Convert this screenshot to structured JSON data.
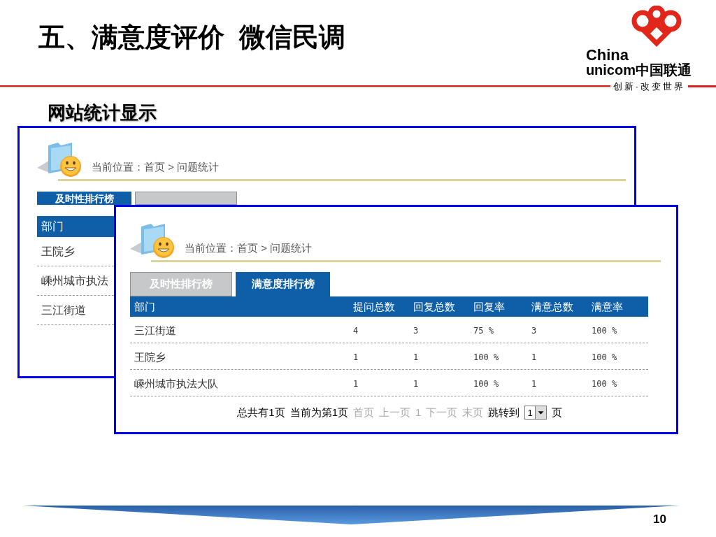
{
  "slide": {
    "title": "五、满意度评价  微信民调",
    "subtitle": "网站统计显示",
    "page_number": "10"
  },
  "logo": {
    "line_1": "China",
    "line_2": "unicom中国联通",
    "tagline": "创新·改变世界"
  },
  "back_panel": {
    "breadcrumb": "当前位置：首页 > 问题统计",
    "tabs": [
      {
        "label": "及时性排行榜",
        "selected": true
      },
      {
        "selected": false
      }
    ],
    "columns": [
      "部门"
    ],
    "rows": [
      [
        "王院乡"
      ],
      [
        "嵊州城市执法"
      ],
      [
        "三江街道"
      ]
    ]
  },
  "front_panel": {
    "breadcrumb": "当前位置：首页 > 问题统计",
    "tabs": [
      {
        "label": "及时性排行榜",
        "selected": false
      },
      {
        "label": "满意度排行榜",
        "selected": true
      }
    ],
    "columns": [
      "部门",
      "提问总数",
      "回复总数",
      "回复率",
      "满意总数",
      "满意率"
    ],
    "rows": [
      [
        "三江街道",
        "4",
        "3",
        "75 %",
        "3",
        "100 %"
      ],
      [
        "王院乡",
        "1",
        "1",
        "100 %",
        "1",
        "100 %"
      ],
      [
        "嵊州城市执法大队",
        "1",
        "1",
        "100 %",
        "1",
        "100 %"
      ]
    ],
    "pagination": [
      {
        "text": "总共有1页",
        "disabled": false
      },
      {
        "text": "当前为第1页",
        "disabled": false
      },
      {
        "text": "首页",
        "disabled": true
      },
      {
        "text": "上一页",
        "disabled": true
      },
      {
        "text": "1",
        "disabled": true
      },
      {
        "text": "下一页",
        "disabled": true
      },
      {
        "text": "末页",
        "disabled": true
      },
      {
        "text": "跳转到",
        "disabled": false
      }
    ],
    "page_select": "1",
    "page_suffix": "页"
  }
}
